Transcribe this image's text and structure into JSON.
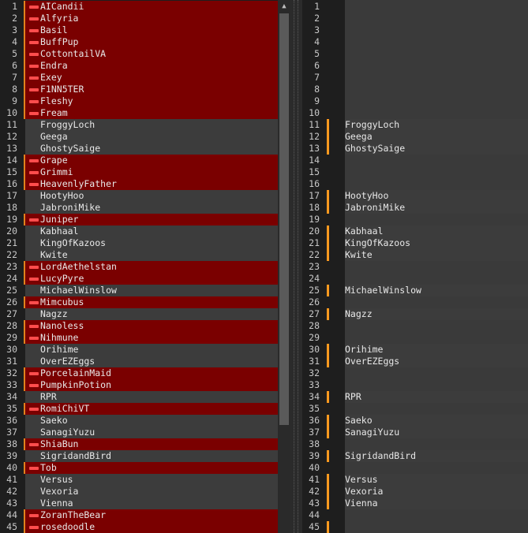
{
  "left": {
    "rows": [
      {
        "n": "1",
        "t": "AICandii",
        "s": "removed"
      },
      {
        "n": "2",
        "t": "Alfyria",
        "s": "removed"
      },
      {
        "n": "3",
        "t": "Basil",
        "s": "removed"
      },
      {
        "n": "4",
        "t": "BuffPup",
        "s": "removed"
      },
      {
        "n": "5",
        "t": "CottontailVA",
        "s": "removed"
      },
      {
        "n": "6",
        "t": "Endra",
        "s": "removed"
      },
      {
        "n": "7",
        "t": "Exey",
        "s": "removed"
      },
      {
        "n": "8",
        "t": "F1NN5TER",
        "s": "removed"
      },
      {
        "n": "9",
        "t": "Fleshy",
        "s": "removed"
      },
      {
        "n": "10",
        "t": "Fream",
        "s": "removed"
      },
      {
        "n": "11",
        "t": "FroggyLoch",
        "s": "same"
      },
      {
        "n": "12",
        "t": "Geega",
        "s": "same"
      },
      {
        "n": "13",
        "t": "GhostySaige",
        "s": "same"
      },
      {
        "n": "14",
        "t": "Grape",
        "s": "removed"
      },
      {
        "n": "15",
        "t": "Grimmi",
        "s": "removed"
      },
      {
        "n": "16",
        "t": "HeavenlyFather",
        "s": "removed"
      },
      {
        "n": "17",
        "t": "HootyHoo",
        "s": "same"
      },
      {
        "n": "18",
        "t": "JabroniMike",
        "s": "same"
      },
      {
        "n": "19",
        "t": "Juniper",
        "s": "removed"
      },
      {
        "n": "20",
        "t": "Kabhaal",
        "s": "same"
      },
      {
        "n": "21",
        "t": "KingOfKazoos",
        "s": "same"
      },
      {
        "n": "22",
        "t": "Kwite",
        "s": "same"
      },
      {
        "n": "23",
        "t": "LordAethelstan",
        "s": "removed"
      },
      {
        "n": "24",
        "t": "LucyPyre",
        "s": "removed"
      },
      {
        "n": "25",
        "t": "MichaelWinslow",
        "s": "same"
      },
      {
        "n": "26",
        "t": "Mimcubus",
        "s": "removed"
      },
      {
        "n": "27",
        "t": "Nagzz",
        "s": "same"
      },
      {
        "n": "28",
        "t": "Nanoless",
        "s": "removed"
      },
      {
        "n": "29",
        "t": "Nihmune",
        "s": "removed"
      },
      {
        "n": "30",
        "t": "Orihime",
        "s": "same"
      },
      {
        "n": "31",
        "t": "OverEZEggs",
        "s": "same"
      },
      {
        "n": "32",
        "t": "PorcelainMaid",
        "s": "removed"
      },
      {
        "n": "33",
        "t": "PumpkinPotion",
        "s": "removed"
      },
      {
        "n": "34",
        "t": "RPR",
        "s": "same"
      },
      {
        "n": "35",
        "t": "RomiChiVT",
        "s": "removed"
      },
      {
        "n": "36",
        "t": "Saeko",
        "s": "same"
      },
      {
        "n": "37",
        "t": "SanagiYuzu",
        "s": "same"
      },
      {
        "n": "38",
        "t": "ShiaBun",
        "s": "removed"
      },
      {
        "n": "39",
        "t": "SigridandBird",
        "s": "same"
      },
      {
        "n": "40",
        "t": "Tob",
        "s": "removed"
      },
      {
        "n": "41",
        "t": "Versus",
        "s": "same"
      },
      {
        "n": "42",
        "t": "Vexoria",
        "s": "same"
      },
      {
        "n": "43",
        "t": "Vienna",
        "s": "same"
      },
      {
        "n": "44",
        "t": "ZoranTheBear",
        "s": "removed"
      },
      {
        "n": "45",
        "t": "rosedoodle",
        "s": "removed"
      }
    ]
  },
  "right": {
    "rows": [
      {
        "n": "1",
        "t": ""
      },
      {
        "n": "2",
        "t": ""
      },
      {
        "n": "3",
        "t": ""
      },
      {
        "n": "4",
        "t": ""
      },
      {
        "n": "5",
        "t": ""
      },
      {
        "n": "6",
        "t": ""
      },
      {
        "n": "7",
        "t": ""
      },
      {
        "n": "8",
        "t": ""
      },
      {
        "n": "9",
        "t": ""
      },
      {
        "n": "10",
        "t": ""
      },
      {
        "n": "11",
        "t": "FroggyLoch"
      },
      {
        "n": "12",
        "t": "Geega"
      },
      {
        "n": "13",
        "t": "GhostySaige"
      },
      {
        "n": "14",
        "t": ""
      },
      {
        "n": "15",
        "t": ""
      },
      {
        "n": "16",
        "t": ""
      },
      {
        "n": "17",
        "t": "HootyHoo"
      },
      {
        "n": "18",
        "t": "JabroniMike"
      },
      {
        "n": "19",
        "t": ""
      },
      {
        "n": "20",
        "t": "Kabhaal"
      },
      {
        "n": "21",
        "t": "KingOfKazoos"
      },
      {
        "n": "22",
        "t": "Kwite"
      },
      {
        "n": "23",
        "t": ""
      },
      {
        "n": "24",
        "t": ""
      },
      {
        "n": "25",
        "t": "MichaelWinslow"
      },
      {
        "n": "26",
        "t": ""
      },
      {
        "n": "27",
        "t": "Nagzz"
      },
      {
        "n": "28",
        "t": ""
      },
      {
        "n": "29",
        "t": ""
      },
      {
        "n": "30",
        "t": "Orihime"
      },
      {
        "n": "31",
        "t": "OverEZEggs"
      },
      {
        "n": "32",
        "t": ""
      },
      {
        "n": "33",
        "t": ""
      },
      {
        "n": "34",
        "t": "RPR"
      },
      {
        "n": "35",
        "t": ""
      },
      {
        "n": "36",
        "t": "Saeko"
      },
      {
        "n": "37",
        "t": "SanagiYuzu"
      },
      {
        "n": "38",
        "t": ""
      },
      {
        "n": "39",
        "t": "SigridandBird"
      },
      {
        "n": "40",
        "t": ""
      },
      {
        "n": "41",
        "t": "Versus"
      },
      {
        "n": "42",
        "t": "Vexoria"
      },
      {
        "n": "43",
        "t": "Vienna"
      },
      {
        "n": "44",
        "t": ""
      },
      {
        "n": "45",
        "t": ""
      }
    ]
  },
  "colors": {
    "removed": "#7a0000",
    "same": "#3c3c3c",
    "minus_icon": "#ff4d4d",
    "change_marker": "#ff9a1f"
  }
}
